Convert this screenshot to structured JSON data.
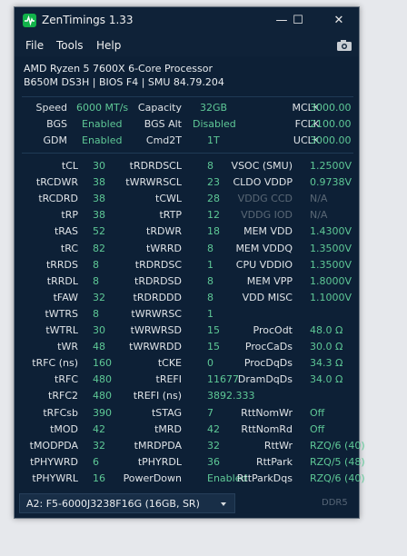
{
  "window": {
    "title": "ZenTimings 1.33",
    "controls": {
      "minimize": "—",
      "maximize": "☐",
      "close": "✕"
    },
    "icon": "zentimings-app-icon"
  },
  "menu": {
    "file": "File",
    "tools": "Tools",
    "help": "Help",
    "screenshot_icon": "camera-icon"
  },
  "system": {
    "cpu": "AMD Ryzen 5 7600X 6-Core Processor",
    "board": "B650M DS3H | BIOS F4 | SMU 84.79.204"
  },
  "top": {
    "speed_label": "Speed",
    "speed_value": "6000 MT/s",
    "capacity_label": "Capacity",
    "capacity_value": "32GB",
    "mclk_label": "MCLK",
    "mclk_value": "3000.00",
    "bgs_label": "BGS",
    "bgs_value": "Enabled",
    "bgsalt_label": "BGS Alt",
    "bgsalt_value": "Disabled",
    "fclk_label": "FCLK",
    "fclk_value": "2100.00",
    "gdm_label": "GDM",
    "gdm_value": "Enabled",
    "cmd2t_label": "Cmd2T",
    "cmd2t_value": "1T",
    "uclk_label": "UCLK",
    "uclk_value": "3000.00"
  },
  "col1": [
    {
      "label": "tCL",
      "value": "30"
    },
    {
      "label": "tRCDWR",
      "value": "38"
    },
    {
      "label": "tRCDRD",
      "value": "38"
    },
    {
      "label": "tRP",
      "value": "38"
    },
    {
      "label": "tRAS",
      "value": "52"
    },
    {
      "label": "tRC",
      "value": "82"
    },
    {
      "label": "tRRDS",
      "value": "8"
    },
    {
      "label": "tRRDL",
      "value": "8"
    },
    {
      "label": "tFAW",
      "value": "32"
    },
    {
      "label": "tWTRS",
      "value": "8"
    },
    {
      "label": "tWTRL",
      "value": "30"
    },
    {
      "label": "tWR",
      "value": "48"
    },
    {
      "label": "tRFC (ns)",
      "value": "160"
    },
    {
      "label": "tRFC",
      "value": "480"
    },
    {
      "label": "tRFC2",
      "value": "480"
    },
    {
      "label": "tRFCsb",
      "value": "390"
    },
    {
      "label": "tMOD",
      "value": "42"
    },
    {
      "label": "tMODPDA",
      "value": "32"
    },
    {
      "label": "tPHYWRD",
      "value": "6"
    },
    {
      "label": "tPHYWRL",
      "value": "16"
    }
  ],
  "col2": [
    {
      "label": "tRDRDSCL",
      "value": "8"
    },
    {
      "label": "tWRWRSCL",
      "value": "23"
    },
    {
      "label": "tCWL",
      "value": "28"
    },
    {
      "label": "tRTP",
      "value": "12"
    },
    {
      "label": "tRDWR",
      "value": "18"
    },
    {
      "label": "tWRRD",
      "value": "8"
    },
    {
      "label": "tRDRDSC",
      "value": "1"
    },
    {
      "label": "tRDRDSD",
      "value": "8"
    },
    {
      "label": "tRDRDDD",
      "value": "8"
    },
    {
      "label": "tWRWRSC",
      "value": "1"
    },
    {
      "label": "tWRWRSD",
      "value": "15"
    },
    {
      "label": "tWRWRDD",
      "value": "15"
    },
    {
      "label": "tCKE",
      "value": "0"
    },
    {
      "label": "tREFI",
      "value": "11677"
    },
    {
      "label": "tREFI (ns)",
      "value": "3892.333"
    },
    {
      "label": "tSTAG",
      "value": "7"
    },
    {
      "label": "tMRD",
      "value": "42"
    },
    {
      "label": "tMRDPDA",
      "value": "32"
    },
    {
      "label": "tPHYRDL",
      "value": "36"
    },
    {
      "label": "PowerDown",
      "value": "Enabled"
    }
  ],
  "col3": [
    {
      "label": "VSOC (SMU)",
      "value": "1.2500V"
    },
    {
      "label": "CLDO VDDP",
      "value": "0.9738V"
    },
    {
      "label": "VDDG CCD",
      "value": "N/A"
    },
    {
      "label": "VDDG IOD",
      "value": "N/A"
    },
    {
      "label": "MEM VDD",
      "value": "1.4300V"
    },
    {
      "label": "MEM VDDQ",
      "value": "1.3500V"
    },
    {
      "label": "CPU VDDIO",
      "value": "1.3500V"
    },
    {
      "label": "MEM VPP",
      "value": "1.8000V"
    },
    {
      "label": "VDD MISC",
      "value": "1.1000V"
    },
    {
      "label": "",
      "value": ""
    },
    {
      "label": "ProcOdt",
      "value": "48.0 Ω"
    },
    {
      "label": "ProcCaDs",
      "value": "30.0 Ω"
    },
    {
      "label": "ProcDqDs",
      "value": "34.3 Ω"
    },
    {
      "label": "DramDqDs",
      "value": "34.0 Ω"
    },
    {
      "label": "",
      "value": ""
    },
    {
      "label": "RttNomWr",
      "value": "Off"
    },
    {
      "label": "RttNomRd",
      "value": "Off"
    },
    {
      "label": "RttWr",
      "value": "RZQ/6 (40)"
    },
    {
      "label": "RttPark",
      "value": "RZQ/5 (48)"
    },
    {
      "label": "RttParkDqs",
      "value": "RZQ/6 (40)"
    }
  ],
  "footer": {
    "dimm_selected": "A2: F5-6000J3238F16G (16GB, SR)",
    "memory_type": "DDR5"
  },
  "colors": {
    "value_green": "#5ec896",
    "dim_gray": "#5a6876",
    "background": "#0d2036"
  }
}
